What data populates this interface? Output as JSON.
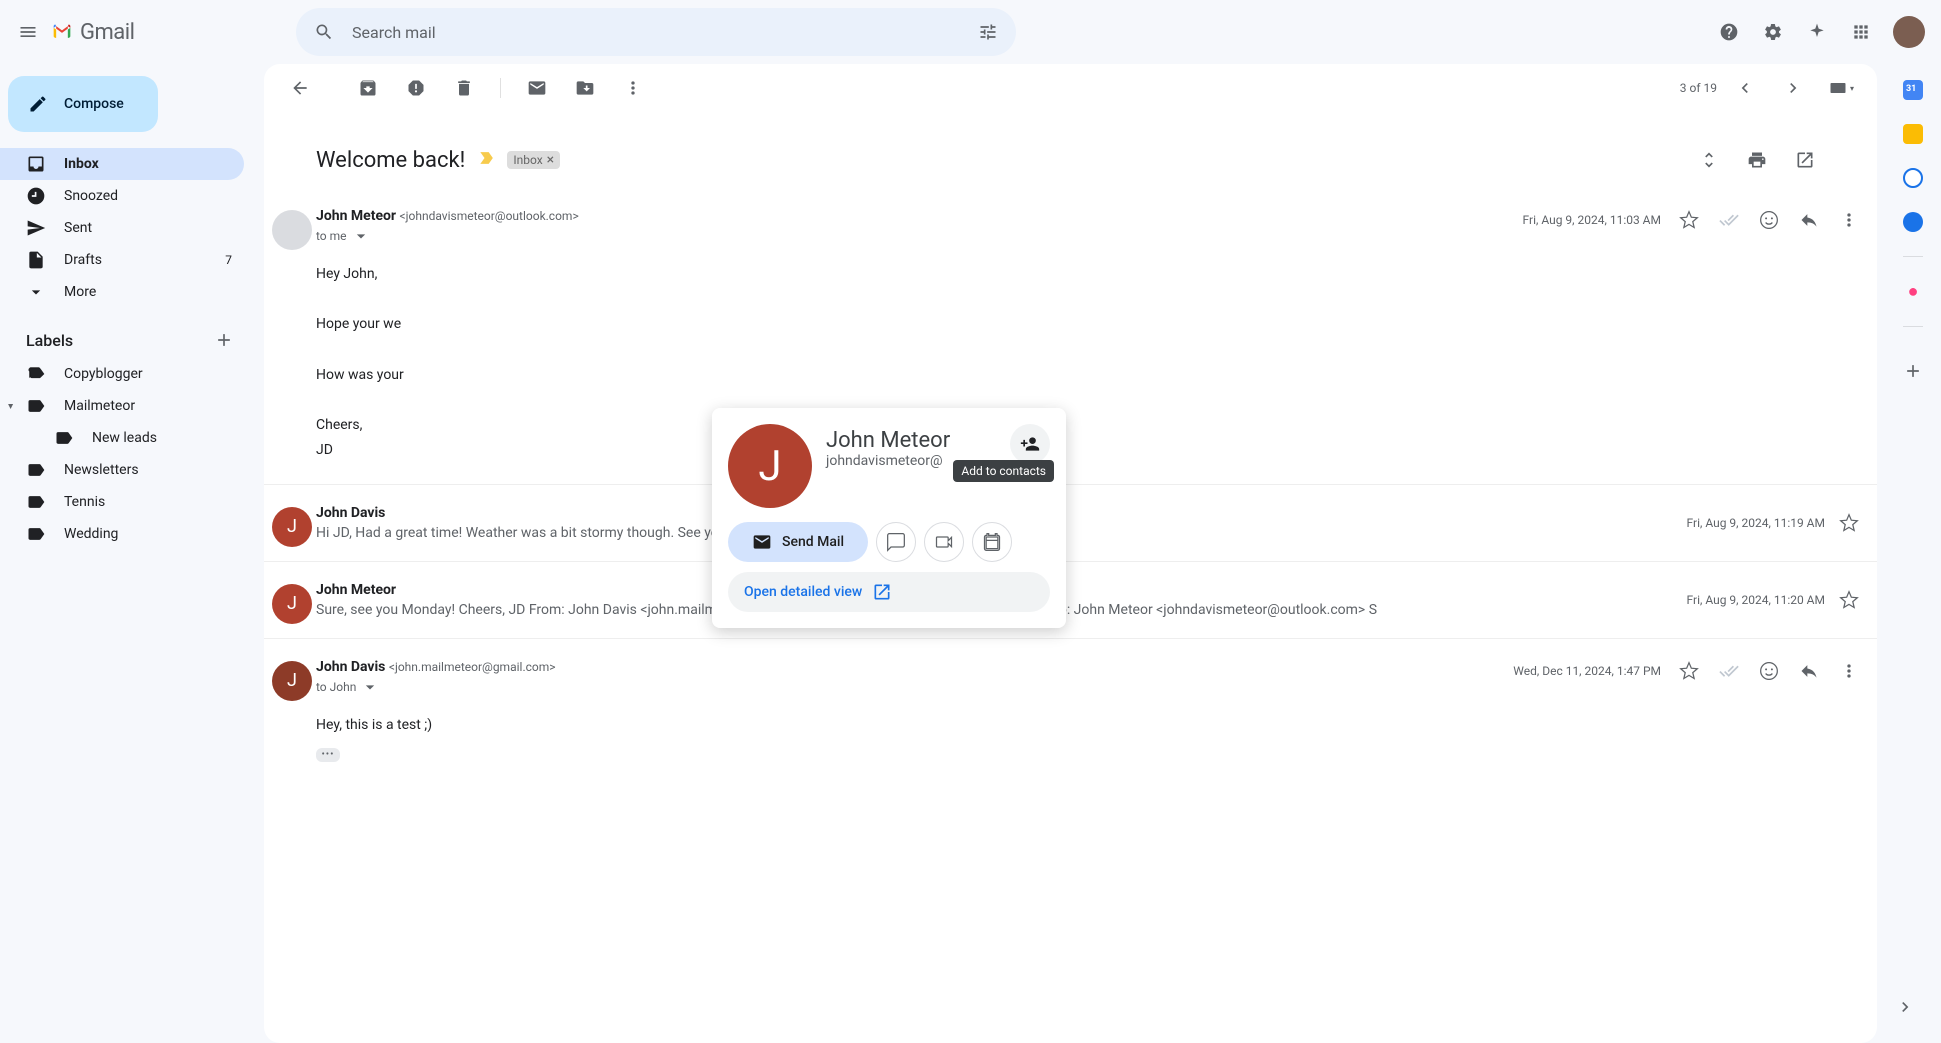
{
  "header": {
    "logo_text": "Gmail",
    "search_placeholder": "Search mail"
  },
  "sidebar": {
    "compose": "Compose",
    "nav": [
      {
        "label": "Inbox",
        "active": true
      },
      {
        "label": "Snoozed"
      },
      {
        "label": "Sent"
      },
      {
        "label": "Drafts",
        "count": "7"
      },
      {
        "label": "More"
      }
    ],
    "labels_header": "Labels",
    "labels": [
      {
        "label": "Copyblogger"
      },
      {
        "label": "Mailmeteor",
        "expandable": true
      },
      {
        "label": "New leads",
        "nested": true
      },
      {
        "label": "Newsletters"
      },
      {
        "label": "Tennis"
      },
      {
        "label": "Wedding"
      }
    ]
  },
  "toolbar": {
    "position": "3 of 19"
  },
  "thread": {
    "subject": "Welcome back!",
    "chip": "Inbox"
  },
  "messages": [
    {
      "from": "John Meteor",
      "email": "<johndavismeteor@outlook.com>",
      "to": "to me",
      "date": "Fri, Aug 9, 2024, 11:03 AM",
      "body": "Hey John,\n\nHope your we\n\nHow was your\n\nCheers,\nJD"
    },
    {
      "from": "John Davis",
      "date": "Fri, Aug 9, 2024, 11:19 AM",
      "snippet": "Hi JD, Had a great time! Weather was a bit stormy though. See you at the office next Monday for lunch? Talk soon, John"
    },
    {
      "from": "John Meteor",
      "date": "Fri, Aug 9, 2024, 11:20 AM",
      "snippet": "Sure, see you Monday! Cheers, JD From: John Davis <john.mailmeteor@gmail.com> Sent: Friday, August 9, 2024 11:19 To: John Meteor <johndavismeteor@outlook.com> S"
    },
    {
      "from": "John Davis",
      "email": "<john.mailmeteor@gmail.com>",
      "to": "to John",
      "date": "Wed, Dec 11, 2024, 1:47 PM",
      "body": "Hey, this is a test ;)"
    }
  ],
  "hovercard": {
    "initial": "J",
    "name": "John Meteor",
    "email": "johndavismeteor@",
    "tooltip": "Add to contacts",
    "send_mail": "Send Mail",
    "detail": "Open detailed view"
  }
}
